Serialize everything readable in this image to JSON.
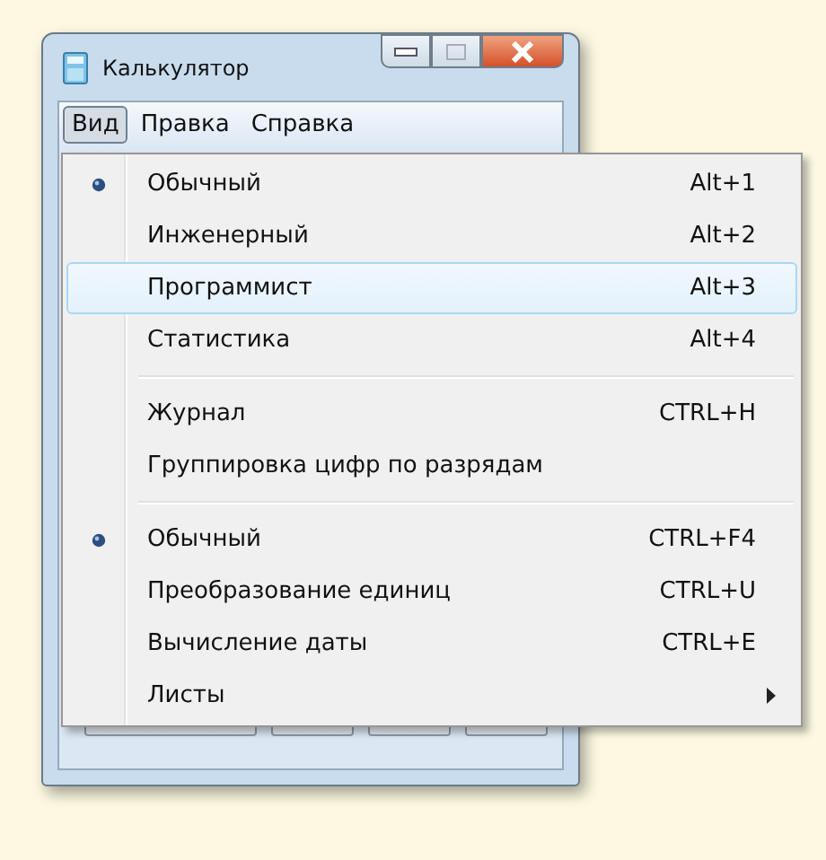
{
  "window": {
    "title": "Калькулятор"
  },
  "menubar": [
    {
      "label": "Вид",
      "selected": true
    },
    {
      "label": "Правка",
      "selected": false
    },
    {
      "label": "Справка",
      "selected": false
    }
  ],
  "menu": [
    {
      "kind": "item",
      "label": "Обычный",
      "shortcut": "Alt+1",
      "checked": true,
      "selected": false
    },
    {
      "kind": "item",
      "label": "Инженерный",
      "shortcut": "Alt+2",
      "checked": false,
      "selected": false
    },
    {
      "kind": "item",
      "label": "Программист",
      "shortcut": "Alt+3",
      "checked": false,
      "selected": true
    },
    {
      "kind": "item",
      "label": "Статистика",
      "shortcut": "Alt+4",
      "checked": false,
      "selected": false
    },
    {
      "kind": "separator"
    },
    {
      "kind": "item",
      "label": "Журнал",
      "shortcut": "CTRL+H",
      "checked": false,
      "selected": false
    },
    {
      "kind": "item",
      "label": "Группировка цифр по разрядам",
      "checked": false,
      "selected": false
    },
    {
      "kind": "separator"
    },
    {
      "kind": "item",
      "label": "Обычный",
      "shortcut": "CTRL+F4",
      "checked": true,
      "selected": false
    },
    {
      "kind": "item",
      "label": "Преобразование единиц",
      "shortcut": "CTRL+U",
      "checked": false,
      "selected": false
    },
    {
      "kind": "item",
      "label": "Вычисление даты",
      "shortcut": "CTRL+E",
      "checked": false,
      "selected": false
    },
    {
      "kind": "submenu",
      "label": "Листы",
      "checked": false,
      "selected": false
    }
  ]
}
